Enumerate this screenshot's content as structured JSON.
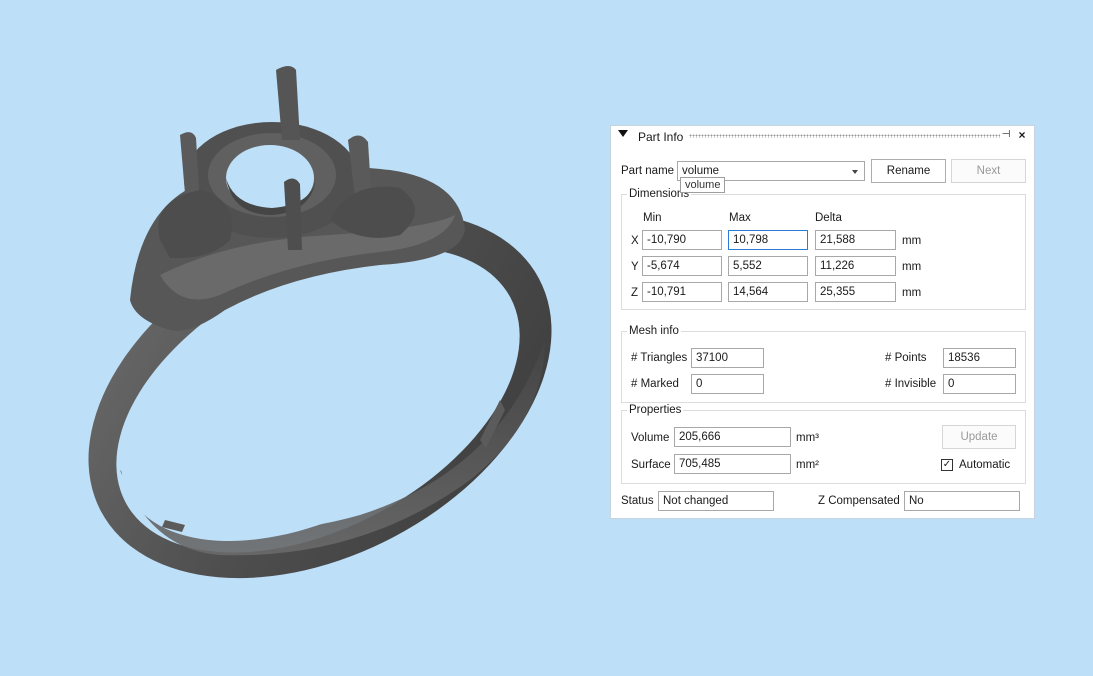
{
  "panel": {
    "title": "Part Info",
    "pin_glyph": "⊣",
    "close_glyph": "×",
    "part_name": {
      "label": "Part name",
      "value": "volume",
      "tooltip": "volume"
    },
    "rename_label": "Rename",
    "next_label": "Next",
    "dimensions": {
      "title": "Dimensions",
      "headers": [
        "Min",
        "Max",
        "Delta"
      ],
      "rows": [
        {
          "axis": "X",
          "min": "-10,790",
          "max": "10,798",
          "delta": "21,588",
          "unit": "mm"
        },
        {
          "axis": "Y",
          "min": "-5,674",
          "max": "5,552",
          "delta": "11,226",
          "unit": "mm"
        },
        {
          "axis": "Z",
          "min": "-10,791",
          "max": "14,564",
          "delta": "25,355",
          "unit": "mm"
        }
      ]
    },
    "mesh": {
      "title": "Mesh info",
      "triangles_label": "# Triangles",
      "triangles": "37100",
      "points_label": "# Points",
      "points": "18536",
      "marked_label": "# Marked",
      "marked": "0",
      "invisible_label": "# Invisible",
      "invisible": "0"
    },
    "properties": {
      "title": "Properties",
      "volume_label": "Volume",
      "volume": "205,666",
      "volume_unit": "mm³",
      "surface_label": "Surface",
      "surface": "705,485",
      "surface_unit": "mm²",
      "update_label": "Update",
      "automatic_label": "Automatic",
      "automatic_checked": true,
      "check_glyph": "✓"
    },
    "status_label": "Status",
    "status": "Not changed",
    "zcomp_label": "Z Compensated",
    "zcomp": "No"
  },
  "colors": {
    "background": "#bddff7",
    "ring": "#5a5a5a",
    "focus": "#2c7bd6"
  }
}
